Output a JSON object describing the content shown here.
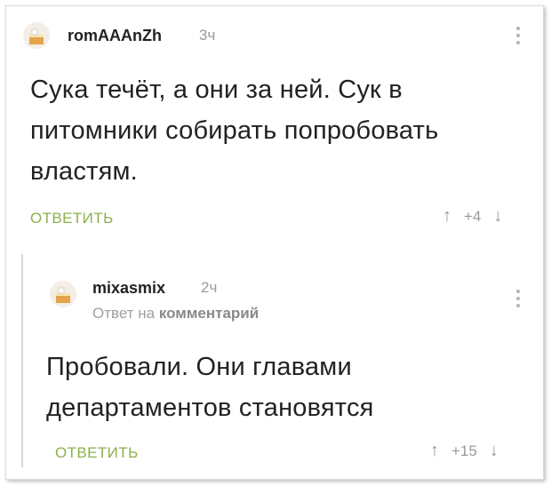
{
  "comment1": {
    "username": "romAAAnZh",
    "time": "3ч",
    "text": "Сука течёт, а они за ней. Сук в питомники собирать попробовать властям.",
    "reply_label": "ОТВЕТИТЬ",
    "vote_up_icon": "arrow-up-icon",
    "vote_down_icon": "arrow-down-icon",
    "score": "+4"
  },
  "comment2": {
    "username": "mixasmix",
    "time": "2ч",
    "reply_prefix": "Ответ на",
    "reply_target": "комментарий",
    "text": "Пробовали. Они главами департаментов становятся",
    "reply_label": "ОТВЕТИТЬ",
    "score": "+15"
  },
  "colors": {
    "reply": "#8cb04e",
    "muted": "#9a9a9a",
    "text": "#222222"
  }
}
